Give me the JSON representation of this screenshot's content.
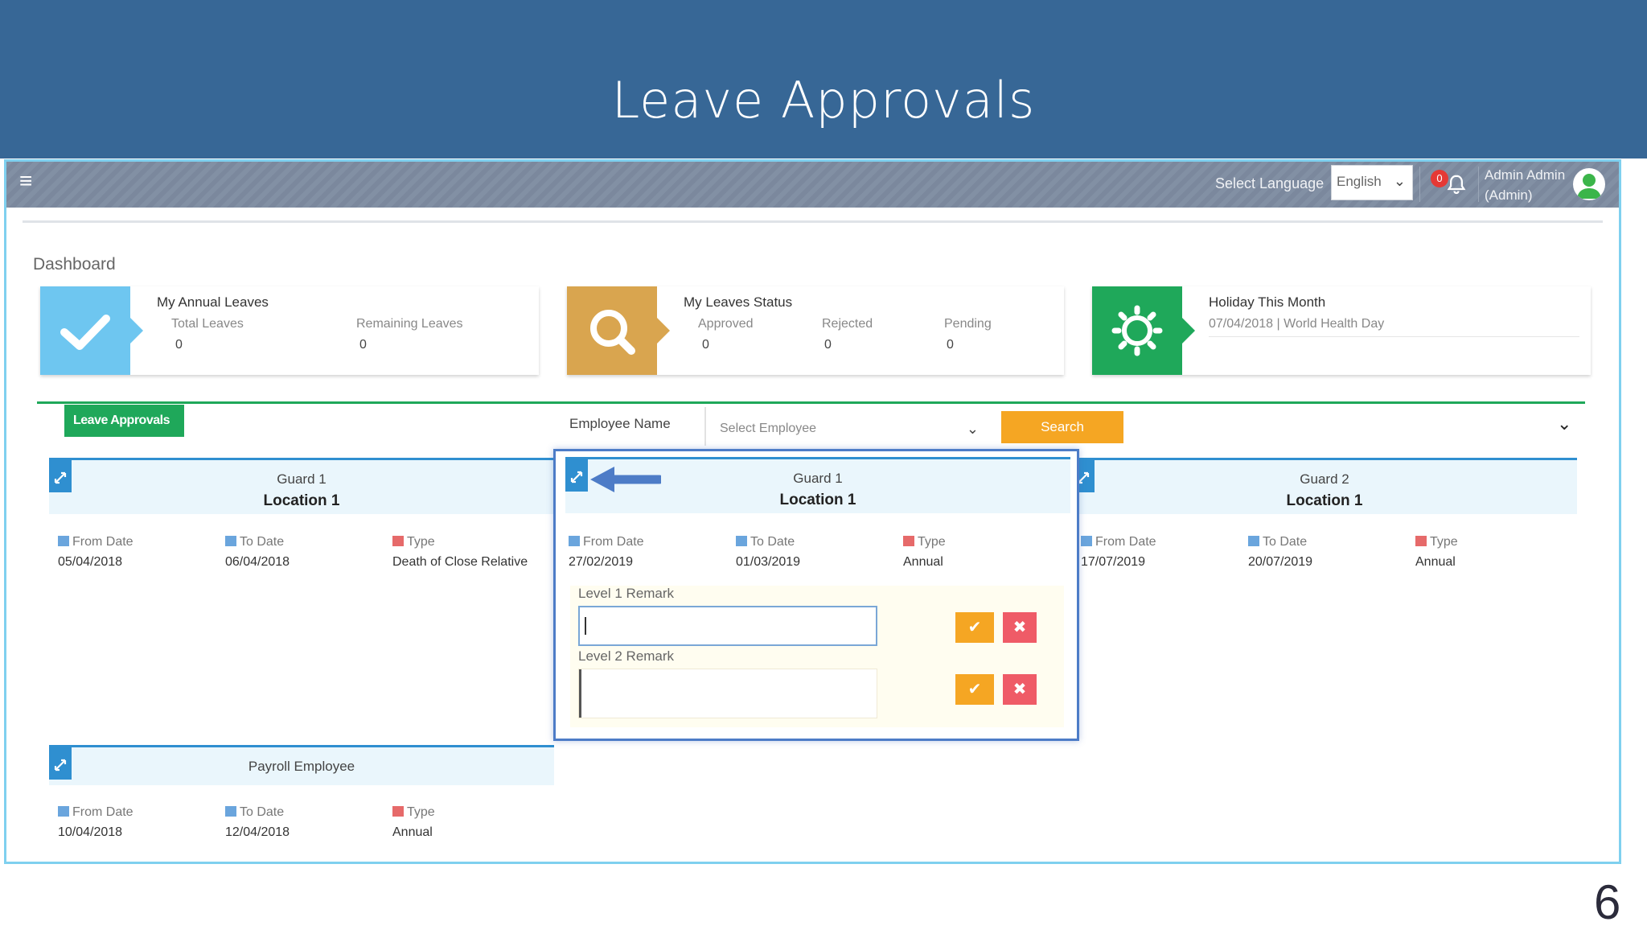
{
  "slide": {
    "title": "Leave Approvals",
    "page_number": "6"
  },
  "topbar": {
    "language_label": "Select Language",
    "language_value": "English",
    "notification_count": "0",
    "user_name": "Admin Admin",
    "user_role": "(Admin)"
  },
  "breadcrumb": "Dashboard",
  "stats": {
    "annual": {
      "title": "My Annual Leaves",
      "total_label": "Total Leaves",
      "total_value": "0",
      "remaining_label": "Remaining Leaves",
      "remaining_value": "0",
      "color": "#6ec6f0"
    },
    "status": {
      "title": "My Leaves Status",
      "approved_label": "Approved",
      "approved_value": "0",
      "rejected_label": "Rejected",
      "rejected_value": "0",
      "pending_label": "Pending",
      "pending_value": "0",
      "color": "#d9a54f"
    },
    "holiday": {
      "title": "Holiday This Month",
      "entry": "07/04/2018 | World Health Day",
      "color": "#1fa85a"
    }
  },
  "section": {
    "tag": "Leave Approvals",
    "employee_label": "Employee Name",
    "employee_placeholder": "Select Employee",
    "search_label": "Search"
  },
  "labels": {
    "from": "From Date",
    "to": "To Date",
    "type": "Type"
  },
  "cards": [
    {
      "name": "Guard 1",
      "location": "Location 1",
      "from": "05/04/2018",
      "to": "06/04/2018",
      "type": "Death of Close Relative"
    },
    {
      "name": "Guard 1",
      "location": "Location 1",
      "from": "27/02/2019",
      "to": "01/03/2019",
      "type": "Annual"
    },
    {
      "name": "Guard 2",
      "location": "Location 1",
      "from": "17/07/2019",
      "to": "20/07/2019",
      "type": "Annual"
    },
    {
      "name": "Payroll Employee",
      "location": "",
      "from": "10/04/2018",
      "to": "12/04/2018",
      "type": "Annual"
    }
  ],
  "popup": {
    "level1_label": "Level 1 Remark",
    "level1_value": "",
    "level2_label": "Level 2 Remark",
    "level2_value": ""
  },
  "colors": {
    "header_blue": "#376796",
    "accent_green": "#1fa85a",
    "accent_orange": "#f5a623",
    "card_blue": "#2f8fd0",
    "reject_red": "#ef5b67"
  }
}
